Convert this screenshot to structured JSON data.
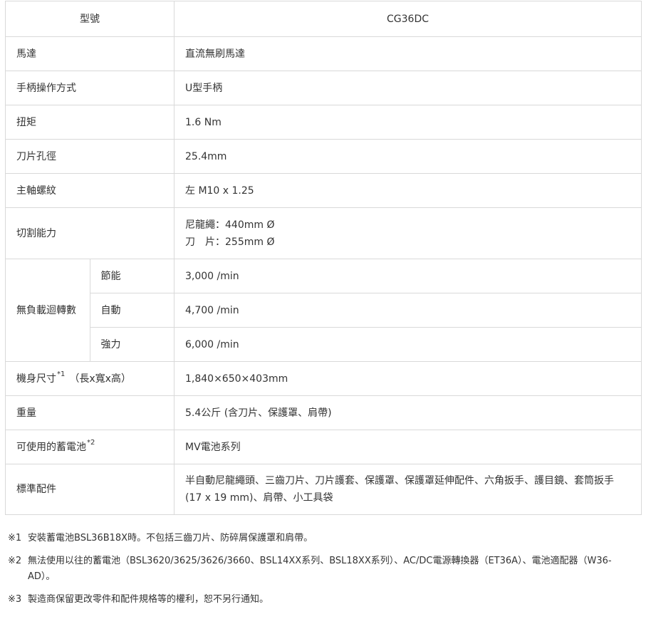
{
  "spec_table": {
    "header": {
      "label": "型號",
      "value": "CG36DC"
    },
    "rows": {
      "motor": {
        "label": "馬達",
        "value": "直流無刷馬達"
      },
      "handle": {
        "label": "手柄操作方式",
        "value": "U型手柄"
      },
      "torque": {
        "label": "扭矩",
        "value": "1.6 Nm"
      },
      "blade_bore": {
        "label": "刀片孔徑",
        "value": "25.4mm"
      },
      "spindle_thread": {
        "label": "主軸螺紋",
        "value": "左 M10 x 1.25"
      },
      "cutting_capacity": {
        "label": "切割能力",
        "line1": "尼龍繩：440mm Ø",
        "line2": "刀　片：255mm Ø"
      },
      "no_load_speed": {
        "label": "無負載迴轉數",
        "modes": [
          {
            "mode": "節能",
            "value": "3,000 /min"
          },
          {
            "mode": "自動",
            "value": "4,700 /min"
          },
          {
            "mode": "強力",
            "value": "6,000 /min"
          }
        ]
      },
      "dimensions": {
        "label": "機身尺寸",
        "sup": "*1",
        "paren": "（長x寬x高）",
        "value": "1,840×650×403mm"
      },
      "weight": {
        "label": "重量",
        "value": "5.4公斤 (含刀片、保護罩、肩帶)"
      },
      "battery": {
        "label": "可使用的蓄電池",
        "sup": "*2",
        "value": "MV電池系列"
      },
      "accessories": {
        "label": "標準配件",
        "value": "半自動尼龍繩頭、三齒刀片、刀片護套、保護罩、保護罩延伸配件、六角扳手、護目鏡、套筒扳手(17 x 19 mm)、肩帶、小工具袋"
      }
    }
  },
  "notes": [
    {
      "mark": "※1",
      "text": "安裝蓄電池BSL36B18X時。不包括三齒刀片、防碎屑保護罩和肩帶。"
    },
    {
      "mark": "※2",
      "text": "無法使用以往的蓄電池（BSL3620/3625/3626/3660、BSL14XX系列、BSL18XX系列）、AC/DC電源轉換器（ET36A）、電池適配器（W36-AD）。"
    },
    {
      "mark": "※3",
      "text": "製造商保留更改零件和配件規格等的權利，恕不另行通知。"
    }
  ]
}
